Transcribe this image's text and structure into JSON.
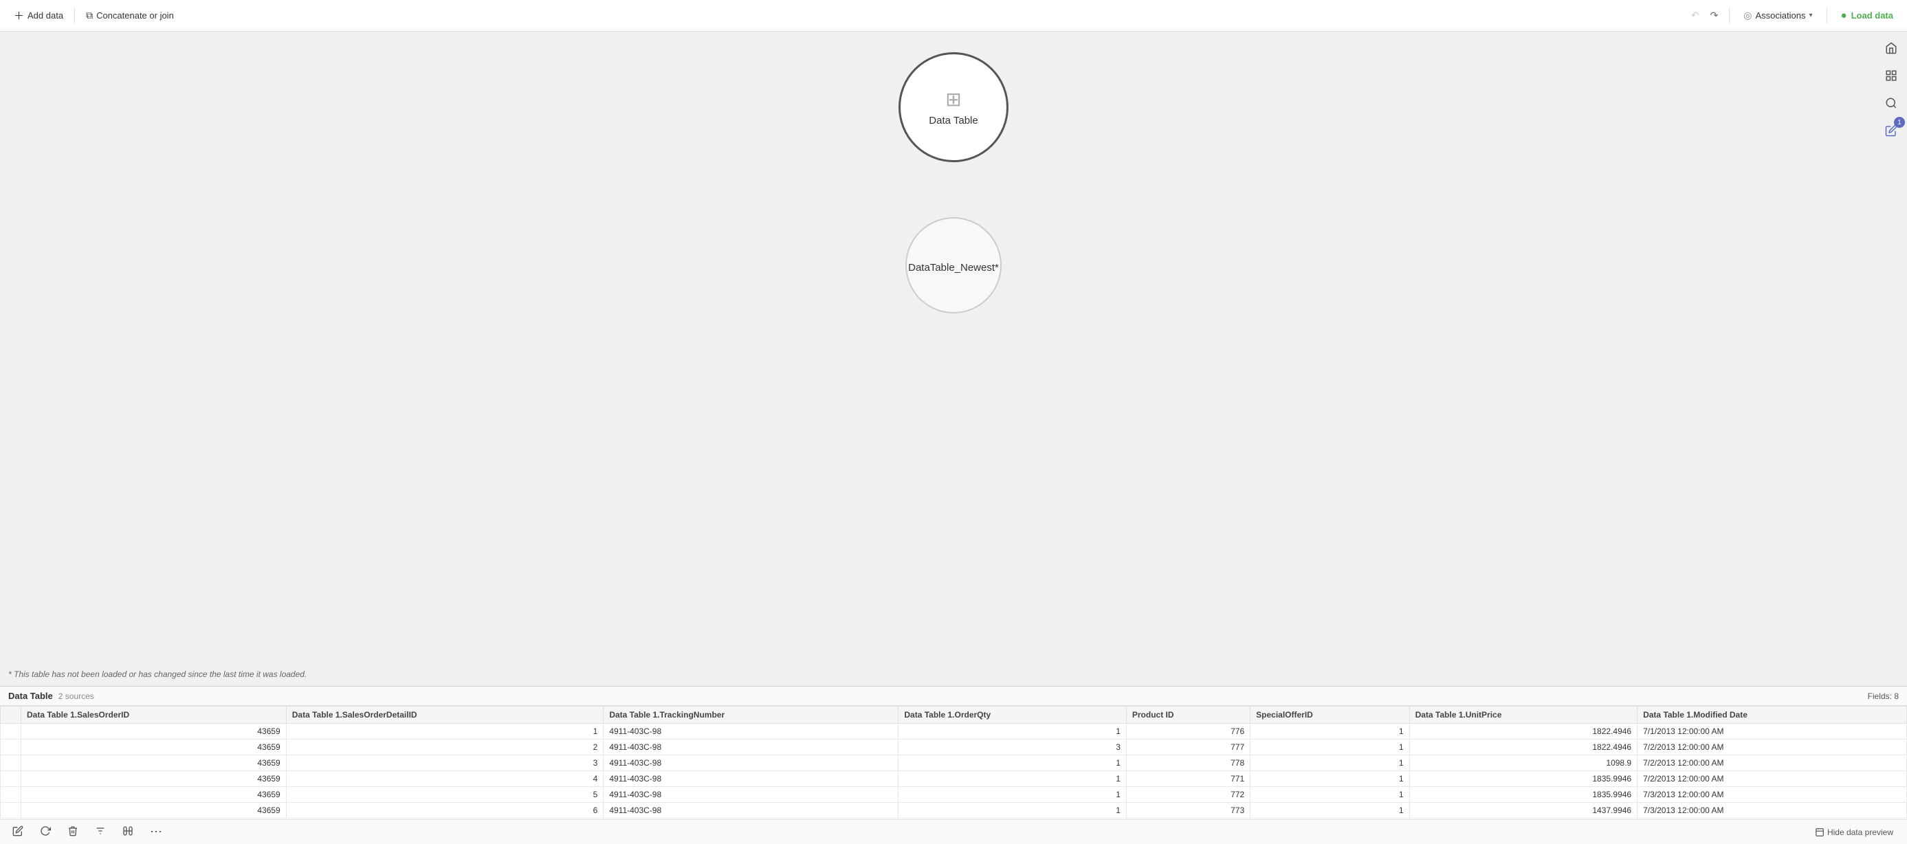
{
  "toolbar": {
    "add_data_label": "Add data",
    "concatenate_label": "Concatenate or join",
    "associations_label": "Associations",
    "load_data_label": "Load data"
  },
  "canvas": {
    "node1": {
      "label": "Data Table",
      "type": "loaded"
    },
    "node2": {
      "label": "DataTable_Newest*",
      "type": "unloaded"
    },
    "warning": "* This table has not been loaded or has changed since the last time it was loaded."
  },
  "right_sidebar": {
    "badge_count": "1"
  },
  "preview": {
    "title": "Data Table",
    "sources": "2 sources",
    "fields_label": "Fields: 8",
    "columns": [
      "Data Table 1.SalesOrderID",
      "Data Table 1.SalesOrderDetailID",
      "Data Table 1.TrackingNumber",
      "Data Table 1.OrderQty",
      "Product ID",
      "SpecialOfferID",
      "Data Table 1.UnitPrice",
      "Data Table 1.Modified Date"
    ],
    "rows": [
      [
        "43659",
        "1",
        "4911-403C-98",
        "1",
        "776",
        "1",
        "1822.4946",
        "7/1/2013 12:00:00 AM"
      ],
      [
        "43659",
        "2",
        "4911-403C-98",
        "3",
        "777",
        "1",
        "1822.4946",
        "7/2/2013 12:00:00 AM"
      ],
      [
        "43659",
        "3",
        "4911-403C-98",
        "1",
        "778",
        "1",
        "1098.9",
        "7/2/2013 12:00:00 AM"
      ],
      [
        "43659",
        "4",
        "4911-403C-98",
        "1",
        "771",
        "1",
        "1835.9946",
        "7/2/2013 12:00:00 AM"
      ],
      [
        "43659",
        "5",
        "4911-403C-98",
        "1",
        "772",
        "1",
        "1835.9946",
        "7/3/2013 12:00:00 AM"
      ],
      [
        "43659",
        "6",
        "4911-403C-98",
        "1",
        "773",
        "1",
        "1437.9946",
        "7/3/2013 12:00:00 AM"
      ]
    ]
  },
  "bottom_toolbar": {
    "hide_preview_label": "Hide data preview"
  }
}
